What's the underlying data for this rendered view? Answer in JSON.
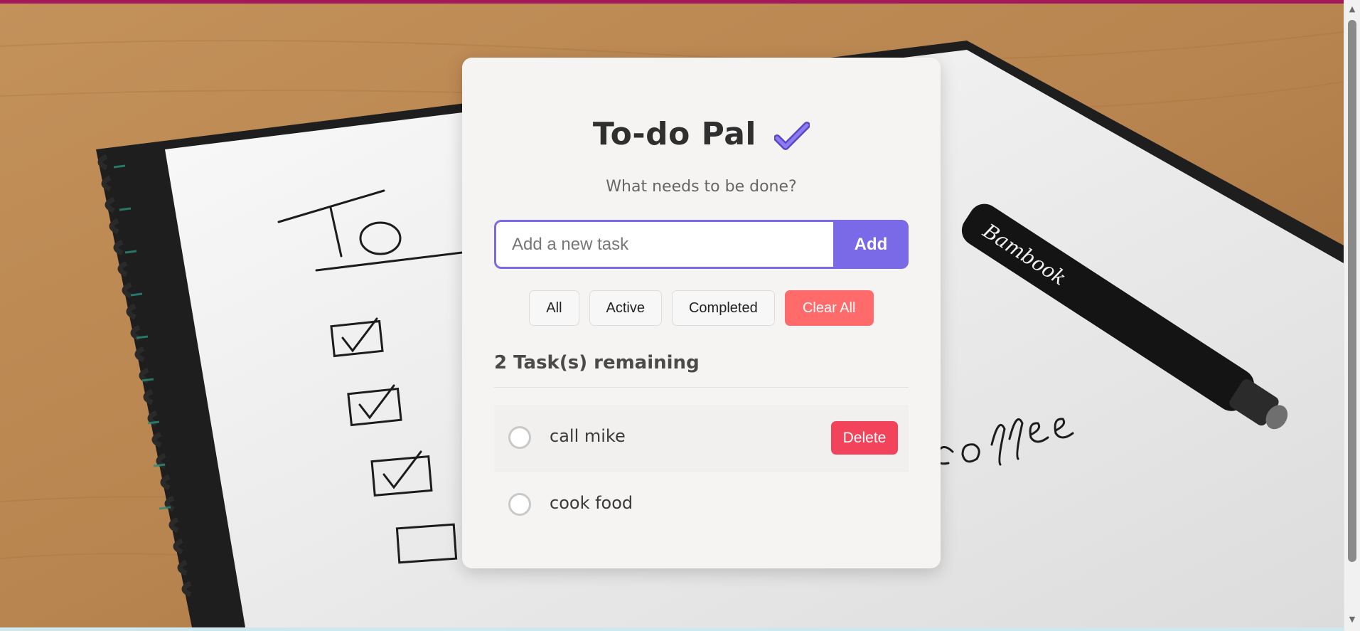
{
  "app": {
    "title": "To-do Pal",
    "title_icon": "check-mark-icon",
    "subtitle": "What needs to be done?"
  },
  "input": {
    "placeholder": "Add a new task",
    "value": "",
    "add_label": "Add"
  },
  "filters": {
    "all_label": "All",
    "active_label": "Active",
    "completed_label": "Completed",
    "clear_label": "Clear All"
  },
  "status": {
    "remaining_text": "2 Task(s) remaining"
  },
  "tasks": [
    {
      "text": "call mike",
      "completed": false,
      "delete_label": "Delete"
    },
    {
      "text": "cook food",
      "completed": false
    }
  ],
  "colors": {
    "accent": "#7b6ae8",
    "danger": "#f2435a",
    "clear": "#ff6b6b",
    "top_strip": "#a3195b"
  }
}
